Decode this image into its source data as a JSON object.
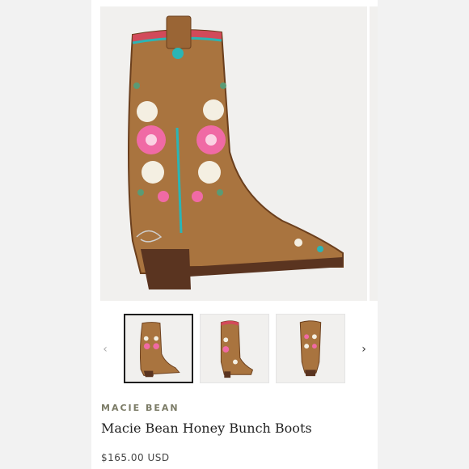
{
  "product": {
    "brand": "MACIE BEAN",
    "title": "Macie Bean Honey Bunch Boots",
    "price": "$165.00 USD"
  },
  "gallery": {
    "prev_icon": "chevron-left-icon",
    "next_icon": "chevron-right-icon",
    "prev_glyph": "‹",
    "next_glyph": "›",
    "active_index": 0,
    "thumbnails": [
      "side-view",
      "angle-view",
      "back-view"
    ]
  },
  "colors": {
    "leather": "#a9743f",
    "leather_dark": "#6b3f1d",
    "sole": "#5a3420",
    "turquoise": "#2bb5b5",
    "pink": "#f06aa5",
    "cream": "#f4efe2",
    "active_border": "#1e1e1e"
  }
}
